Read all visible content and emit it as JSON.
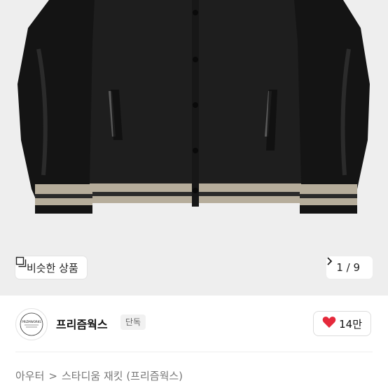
{
  "photo": {
    "similar_button": {
      "label": "비슷한 상품",
      "icon": "similar-items-icon"
    },
    "counter": {
      "text": "1 / 9",
      "icon": "chevron-right-icon"
    }
  },
  "seller": {
    "name": "프리즘웍스",
    "badge": "단독",
    "avatar_logo_text": "PRIZMWORKS",
    "like": {
      "icon": "heart-icon",
      "count": "14만",
      "color": "#e5293b"
    }
  },
  "breadcrumb": {
    "category": "아우터",
    "separator": ">",
    "product": "스타디움 재킷 (프리즘웍스)"
  }
}
